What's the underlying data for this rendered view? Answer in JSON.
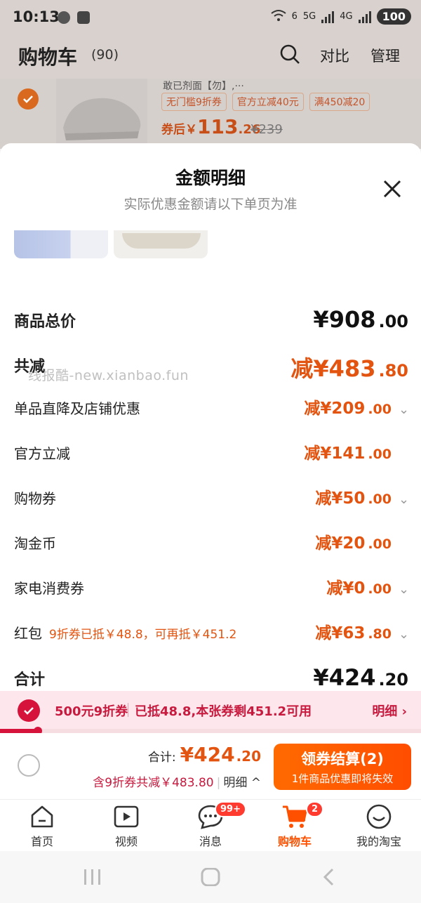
{
  "status_bar": {
    "time": "10:13",
    "net_6": "6",
    "net_5g": "5G",
    "net_4g": "4G",
    "battery": "100"
  },
  "header": {
    "title": "购物车",
    "count": "(90)",
    "compare_label": "对比",
    "manage_label": "管理"
  },
  "behind_product": {
    "title_fragment": "敢已剂面【勿】,···",
    "tags": [
      "无门槛9折券",
      "官方立减40元",
      "满450减20"
    ],
    "after_label": "券后￥",
    "price_int": "113",
    "price_dec": ".26",
    "orig_price": "¥239"
  },
  "sheet": {
    "title": "金额明细",
    "subtitle": "实际优惠金额请以下单页为准",
    "watermark": "线报酷-new.xianbao.fun",
    "rows": [
      {
        "label": "商品总价",
        "amount_int": "¥908",
        "amount_dec": ".00"
      },
      {
        "label": "共减",
        "amount_int": "减¥483",
        "amount_dec": ".80"
      },
      {
        "label": "单品直降及店铺优惠",
        "amount_int": "减¥209",
        "amount_dec": ".00"
      },
      {
        "label": "官方立减",
        "amount_int": "减¥141",
        "amount_dec": ".00"
      },
      {
        "label": "购物券",
        "amount_int": "减¥50",
        "amount_dec": ".00"
      },
      {
        "label": "淘金币",
        "amount_int": "减¥20",
        "amount_dec": ".00"
      },
      {
        "label": "家电消费券",
        "amount_int": "减¥0",
        "amount_dec": ".00"
      },
      {
        "label": "红包",
        "hint": "9折券已抵￥48.8，可再抵￥451.2",
        "amount_int": "减¥63",
        "amount_dec": ".80"
      },
      {
        "label": "合计",
        "amount_int": "¥424",
        "amount_dec": ".20"
      }
    ]
  },
  "coupon_bar": {
    "name": "500元9折券",
    "message": "已抵48.8,本张券剩451.2可用",
    "detail": "明细 ›",
    "progress": 0.09
  },
  "checkout": {
    "total_label": "合计:",
    "total_int": "¥424",
    "total_dec": ".20",
    "saving": "含9折券共减￥483.80",
    "detail": "明细 ^",
    "button": "领券结算(2)",
    "button_sub": "1件商品优惠即将失效"
  },
  "tabs": [
    {
      "label": "首页",
      "icon": "home-icon"
    },
    {
      "label": "视频",
      "icon": "video-icon"
    },
    {
      "label": "消息",
      "icon": "message-icon",
      "badge": "99+"
    },
    {
      "label": "购物车",
      "icon": "cart-icon",
      "badge": "2",
      "active": true
    },
    {
      "label": "我的淘宝",
      "icon": "profile-icon"
    }
  ],
  "colors": {
    "accent": "#e2540f",
    "coupon_red": "#c71a3e",
    "button_orange": "#ff5a00"
  }
}
